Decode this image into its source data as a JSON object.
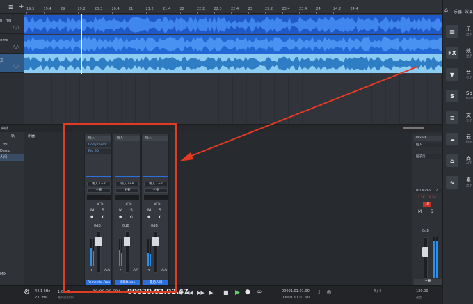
{
  "ruler": {
    "ticks": [
      "19.3",
      "19.4",
      "29",
      "29.2",
      "20.3",
      "20.4",
      "21",
      "21.2",
      "21.4",
      "22",
      "22.2",
      "22.3",
      "22.4",
      "23",
      "23.2",
      "23.4",
      "23.4",
      "24",
      "24.2",
      "24.4"
    ]
  },
  "tracks": [
    {
      "label": "n. You",
      "color": "#2466d9"
    },
    {
      "label": "emo",
      "color": "#2d72e0"
    },
    {
      "label": "高",
      "color": "#4aa2e3"
    }
  ],
  "arrangement_footer": {
    "left": "曲线"
  },
  "mix_list": {
    "header": "轨",
    "items": [
      ". You",
      "Demo",
      "人间"
    ],
    "header2": "乐器",
    "footer": "MIX"
  },
  "strips": [
    {
      "insert_header": "插入",
      "inserts": [
        "Compressor",
        "Pro EQ"
      ],
      "input": "输入 L+R",
      "output": "主要",
      "mute": "M",
      "solo": "S",
      "volume": "0dB",
      "number": "1",
      "name": "Rememb.. You"
    },
    {
      "insert_header": "插入",
      "inserts": [],
      "input": "输入 L+R",
      "output": "主要",
      "mute": "M",
      "solo": "S",
      "volume": "0dB",
      "number": "2",
      "name": "珍珠Demo"
    },
    {
      "insert_header": "插入",
      "inserts": [],
      "input": "输入 L+R",
      "output": "主要",
      "mute": "M",
      "solo": "S",
      "volume": "0dB",
      "number": "3",
      "name": "最后人间"
    }
  ],
  "main_out": {
    "fx": "Mix FX",
    "insert": "插入",
    "send": "插子页",
    "device": "HD Audio ... 2",
    "peak_l": "-1.2K",
    "peak_r": "8.54",
    "clip": "18",
    "mute": "M",
    "solo": "S",
    "volume": "0dB",
    "name": "主要"
  },
  "transport": {
    "sample_rate": "44.1 kHz",
    "latency": "2.0 ms",
    "record_time": "1:09 天",
    "record_sub": "最大录音时间",
    "time": "00:00:36.684",
    "bars": "00020.02.02.47",
    "loop_start": "00001.01.01.00",
    "loop_end": "00001.01.01.00",
    "signature": "4 / 4",
    "tempo": "120.00",
    "tempo_label": "速度"
  },
  "right_panel": {
    "tab1": "乐器",
    "tab2": "效果",
    "items": [
      {
        "icon": "piano-icon",
        "label": "乐",
        "sub": "显示"
      },
      {
        "icon": "fx-icon",
        "label": "效",
        "sub": "显示"
      },
      {
        "icon": "shield-icon",
        "label": "音",
        "sub": "显示"
      },
      {
        "icon": "spark-icon",
        "label": "Sp",
        "sub": "Insta"
      },
      {
        "icon": "document-icon",
        "label": "文",
        "sub": "显示"
      },
      {
        "icon": "cloud-icon",
        "label": "云",
        "sub": "Pres"
      },
      {
        "icon": "shop-icon",
        "label": "商",
        "sub": "APP"
      },
      {
        "icon": "wave-icon",
        "label": "素",
        "sub": "显示"
      }
    ]
  }
}
